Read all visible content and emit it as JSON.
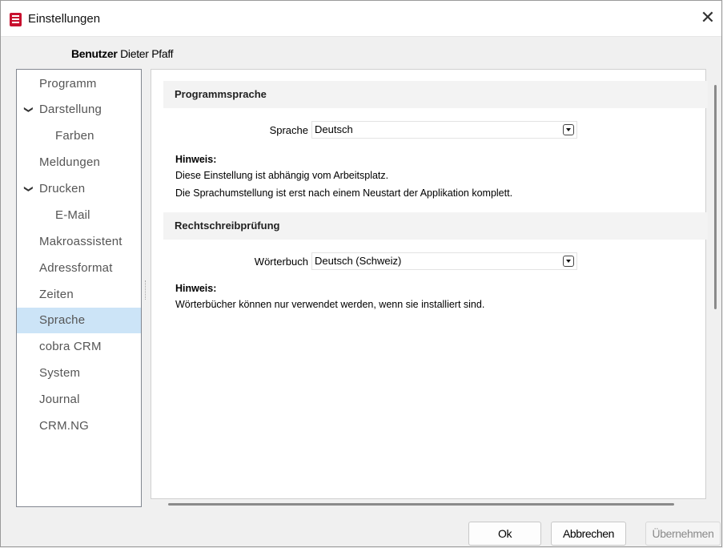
{
  "window": {
    "title": "Einstellungen",
    "close_glyph": "✕"
  },
  "user": {
    "label": "Benutzer",
    "name": "Dieter Pfaff"
  },
  "nav": {
    "items": [
      {
        "label": "Programm",
        "expander": "",
        "selected": false
      },
      {
        "label": "Darstellung",
        "expander": "chevron-down",
        "selected": false
      },
      {
        "label": "Farben",
        "expander": "",
        "selected": false
      },
      {
        "label": "Meldungen",
        "expander": "",
        "selected": false
      },
      {
        "label": "Drucken",
        "expander": "chevron-down",
        "selected": false
      },
      {
        "label": "E-Mail",
        "expander": "",
        "selected": false
      },
      {
        "label": "Makroassistent",
        "expander": "",
        "selected": false
      },
      {
        "label": "Adressformat",
        "expander": "",
        "selected": false
      },
      {
        "label": "Zeiten",
        "expander": "",
        "selected": false
      },
      {
        "label": "Sprache",
        "expander": "",
        "selected": true
      },
      {
        "label": "cobra CRM",
        "expander": "",
        "selected": false
      },
      {
        "label": "System",
        "expander": "",
        "selected": false
      },
      {
        "label": "Journal",
        "expander": "",
        "selected": false
      },
      {
        "label": "CRM.NG",
        "expander": "",
        "selected": false
      }
    ]
  },
  "sections": {
    "language": {
      "header": "Programmsprache",
      "field_label": "Sprache",
      "field_value": "Deutsch",
      "note_title": "Hinweis:",
      "note_line1": "Diese Einstellung ist abhängig vom Arbeitsplatz.",
      "note_line2": "Die Sprachumstellung ist erst nach einem Neustart der Applikation komplett."
    },
    "spelling": {
      "header": "Rechtschreibprüfung",
      "field_label": "Wörterbuch",
      "field_value": "Deutsch (Schweiz)",
      "note_title": "Hinweis:",
      "note_line1": "Wörterbücher können nur verwendet werden, wenn sie installiert sind."
    }
  },
  "buttons": {
    "ok": "Ok",
    "cancel": "Abbrechen",
    "apply": "Übernehmen"
  },
  "colors": {
    "selection": "#cce4f7",
    "app_icon": "#c8102e"
  }
}
